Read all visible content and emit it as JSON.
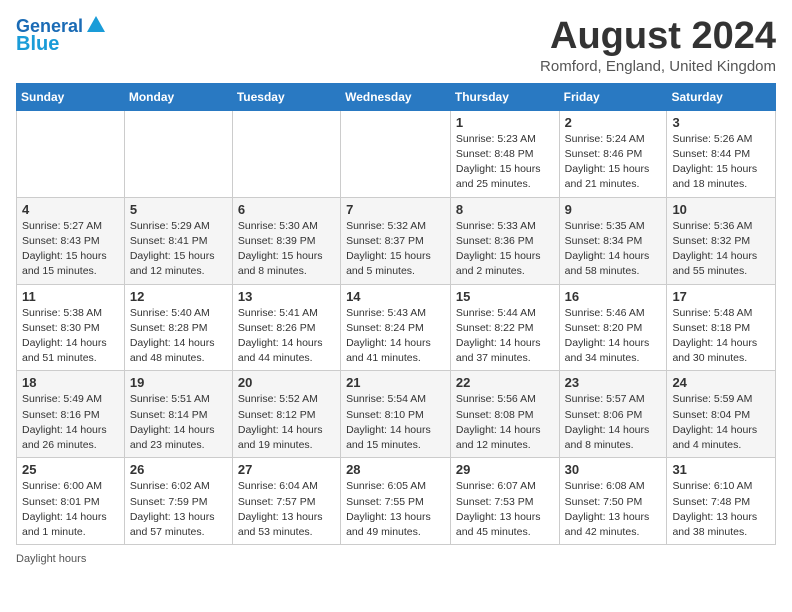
{
  "header": {
    "logo_line1": "General",
    "logo_line2": "Blue",
    "month_year": "August 2024",
    "location": "Romford, England, United Kingdom"
  },
  "days_of_week": [
    "Sunday",
    "Monday",
    "Tuesday",
    "Wednesday",
    "Thursday",
    "Friday",
    "Saturday"
  ],
  "weeks": [
    [
      {
        "day": "",
        "info": ""
      },
      {
        "day": "",
        "info": ""
      },
      {
        "day": "",
        "info": ""
      },
      {
        "day": "",
        "info": ""
      },
      {
        "day": "1",
        "info": "Sunrise: 5:23 AM\nSunset: 8:48 PM\nDaylight: 15 hours\nand 25 minutes."
      },
      {
        "day": "2",
        "info": "Sunrise: 5:24 AM\nSunset: 8:46 PM\nDaylight: 15 hours\nand 21 minutes."
      },
      {
        "day": "3",
        "info": "Sunrise: 5:26 AM\nSunset: 8:44 PM\nDaylight: 15 hours\nand 18 minutes."
      }
    ],
    [
      {
        "day": "4",
        "info": "Sunrise: 5:27 AM\nSunset: 8:43 PM\nDaylight: 15 hours\nand 15 minutes."
      },
      {
        "day": "5",
        "info": "Sunrise: 5:29 AM\nSunset: 8:41 PM\nDaylight: 15 hours\nand 12 minutes."
      },
      {
        "day": "6",
        "info": "Sunrise: 5:30 AM\nSunset: 8:39 PM\nDaylight: 15 hours\nand 8 minutes."
      },
      {
        "day": "7",
        "info": "Sunrise: 5:32 AM\nSunset: 8:37 PM\nDaylight: 15 hours\nand 5 minutes."
      },
      {
        "day": "8",
        "info": "Sunrise: 5:33 AM\nSunset: 8:36 PM\nDaylight: 15 hours\nand 2 minutes."
      },
      {
        "day": "9",
        "info": "Sunrise: 5:35 AM\nSunset: 8:34 PM\nDaylight: 14 hours\nand 58 minutes."
      },
      {
        "day": "10",
        "info": "Sunrise: 5:36 AM\nSunset: 8:32 PM\nDaylight: 14 hours\nand 55 minutes."
      }
    ],
    [
      {
        "day": "11",
        "info": "Sunrise: 5:38 AM\nSunset: 8:30 PM\nDaylight: 14 hours\nand 51 minutes."
      },
      {
        "day": "12",
        "info": "Sunrise: 5:40 AM\nSunset: 8:28 PM\nDaylight: 14 hours\nand 48 minutes."
      },
      {
        "day": "13",
        "info": "Sunrise: 5:41 AM\nSunset: 8:26 PM\nDaylight: 14 hours\nand 44 minutes."
      },
      {
        "day": "14",
        "info": "Sunrise: 5:43 AM\nSunset: 8:24 PM\nDaylight: 14 hours\nand 41 minutes."
      },
      {
        "day": "15",
        "info": "Sunrise: 5:44 AM\nSunset: 8:22 PM\nDaylight: 14 hours\nand 37 minutes."
      },
      {
        "day": "16",
        "info": "Sunrise: 5:46 AM\nSunset: 8:20 PM\nDaylight: 14 hours\nand 34 minutes."
      },
      {
        "day": "17",
        "info": "Sunrise: 5:48 AM\nSunset: 8:18 PM\nDaylight: 14 hours\nand 30 minutes."
      }
    ],
    [
      {
        "day": "18",
        "info": "Sunrise: 5:49 AM\nSunset: 8:16 PM\nDaylight: 14 hours\nand 26 minutes."
      },
      {
        "day": "19",
        "info": "Sunrise: 5:51 AM\nSunset: 8:14 PM\nDaylight: 14 hours\nand 23 minutes."
      },
      {
        "day": "20",
        "info": "Sunrise: 5:52 AM\nSunset: 8:12 PM\nDaylight: 14 hours\nand 19 minutes."
      },
      {
        "day": "21",
        "info": "Sunrise: 5:54 AM\nSunset: 8:10 PM\nDaylight: 14 hours\nand 15 minutes."
      },
      {
        "day": "22",
        "info": "Sunrise: 5:56 AM\nSunset: 8:08 PM\nDaylight: 14 hours\nand 12 minutes."
      },
      {
        "day": "23",
        "info": "Sunrise: 5:57 AM\nSunset: 8:06 PM\nDaylight: 14 hours\nand 8 minutes."
      },
      {
        "day": "24",
        "info": "Sunrise: 5:59 AM\nSunset: 8:04 PM\nDaylight: 14 hours\nand 4 minutes."
      }
    ],
    [
      {
        "day": "25",
        "info": "Sunrise: 6:00 AM\nSunset: 8:01 PM\nDaylight: 14 hours\nand 1 minute."
      },
      {
        "day": "26",
        "info": "Sunrise: 6:02 AM\nSunset: 7:59 PM\nDaylight: 13 hours\nand 57 minutes."
      },
      {
        "day": "27",
        "info": "Sunrise: 6:04 AM\nSunset: 7:57 PM\nDaylight: 13 hours\nand 53 minutes."
      },
      {
        "day": "28",
        "info": "Sunrise: 6:05 AM\nSunset: 7:55 PM\nDaylight: 13 hours\nand 49 minutes."
      },
      {
        "day": "29",
        "info": "Sunrise: 6:07 AM\nSunset: 7:53 PM\nDaylight: 13 hours\nand 45 minutes."
      },
      {
        "day": "30",
        "info": "Sunrise: 6:08 AM\nSunset: 7:50 PM\nDaylight: 13 hours\nand 42 minutes."
      },
      {
        "day": "31",
        "info": "Sunrise: 6:10 AM\nSunset: 7:48 PM\nDaylight: 13 hours\nand 38 minutes."
      }
    ]
  ],
  "footer": "Daylight hours"
}
